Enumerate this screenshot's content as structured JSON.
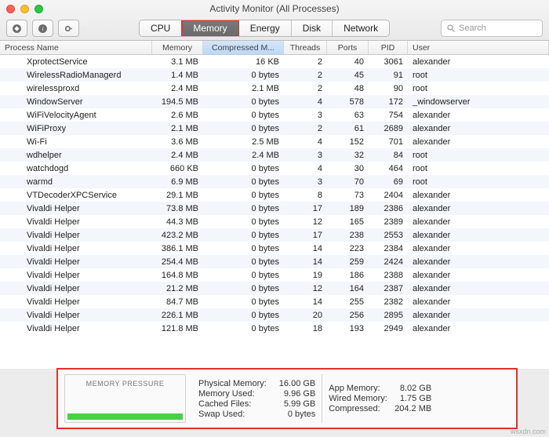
{
  "window": {
    "title": "Activity Monitor (All Processes)"
  },
  "toolbar": {
    "tabs": {
      "cpu": "CPU",
      "memory": "Memory",
      "energy": "Energy",
      "disk": "Disk",
      "network": "Network"
    }
  },
  "search": {
    "placeholder": "Search"
  },
  "columns": {
    "name": "Process Name",
    "memory": "Memory",
    "compressed": "Compressed M...",
    "threads": "Threads",
    "ports": "Ports",
    "pid": "PID",
    "user": "User"
  },
  "processes": [
    {
      "name": "XprotectService",
      "mem": "3.1 MB",
      "comp": "16 KB",
      "thr": "2",
      "port": "40",
      "pid": "3061",
      "user": "alexander"
    },
    {
      "name": "WirelessRadioManagerd",
      "mem": "1.4 MB",
      "comp": "0 bytes",
      "thr": "2",
      "port": "45",
      "pid": "91",
      "user": "root"
    },
    {
      "name": "wirelessproxd",
      "mem": "2.4 MB",
      "comp": "2.1 MB",
      "thr": "2",
      "port": "48",
      "pid": "90",
      "user": "root"
    },
    {
      "name": "WindowServer",
      "mem": "194.5 MB",
      "comp": "0 bytes",
      "thr": "4",
      "port": "578",
      "pid": "172",
      "user": "_windowserver"
    },
    {
      "name": "WiFiVelocityAgent",
      "mem": "2.6 MB",
      "comp": "0 bytes",
      "thr": "3",
      "port": "63",
      "pid": "754",
      "user": "alexander"
    },
    {
      "name": "WiFiProxy",
      "mem": "2.1 MB",
      "comp": "0 bytes",
      "thr": "2",
      "port": "61",
      "pid": "2689",
      "user": "alexander"
    },
    {
      "name": "Wi-Fi",
      "mem": "3.6 MB",
      "comp": "2.5 MB",
      "thr": "4",
      "port": "152",
      "pid": "701",
      "user": "alexander"
    },
    {
      "name": "wdhelper",
      "mem": "2.4 MB",
      "comp": "2.4 MB",
      "thr": "3",
      "port": "32",
      "pid": "84",
      "user": "root"
    },
    {
      "name": "watchdogd",
      "mem": "660 KB",
      "comp": "0 bytes",
      "thr": "4",
      "port": "30",
      "pid": "464",
      "user": "root"
    },
    {
      "name": "warmd",
      "mem": "6.9 MB",
      "comp": "0 bytes",
      "thr": "3",
      "port": "70",
      "pid": "69",
      "user": "root"
    },
    {
      "name": "VTDecoderXPCService",
      "mem": "29.1 MB",
      "comp": "0 bytes",
      "thr": "8",
      "port": "73",
      "pid": "2404",
      "user": "alexander"
    },
    {
      "name": "Vivaldi Helper",
      "mem": "73.8 MB",
      "comp": "0 bytes",
      "thr": "17",
      "port": "189",
      "pid": "2386",
      "user": "alexander"
    },
    {
      "name": "Vivaldi Helper",
      "mem": "44.3 MB",
      "comp": "0 bytes",
      "thr": "12",
      "port": "165",
      "pid": "2389",
      "user": "alexander"
    },
    {
      "name": "Vivaldi Helper",
      "mem": "423.2 MB",
      "comp": "0 bytes",
      "thr": "17",
      "port": "238",
      "pid": "2553",
      "user": "alexander"
    },
    {
      "name": "Vivaldi Helper",
      "mem": "386.1 MB",
      "comp": "0 bytes",
      "thr": "14",
      "port": "223",
      "pid": "2384",
      "user": "alexander"
    },
    {
      "name": "Vivaldi Helper",
      "mem": "254.4 MB",
      "comp": "0 bytes",
      "thr": "14",
      "port": "259",
      "pid": "2424",
      "user": "alexander"
    },
    {
      "name": "Vivaldi Helper",
      "mem": "164.8 MB",
      "comp": "0 bytes",
      "thr": "19",
      "port": "186",
      "pid": "2388",
      "user": "alexander"
    },
    {
      "name": "Vivaldi Helper",
      "mem": "21.2 MB",
      "comp": "0 bytes",
      "thr": "12",
      "port": "164",
      "pid": "2387",
      "user": "alexander"
    },
    {
      "name": "Vivaldi Helper",
      "mem": "84.7 MB",
      "comp": "0 bytes",
      "thr": "14",
      "port": "255",
      "pid": "2382",
      "user": "alexander"
    },
    {
      "name": "Vivaldi Helper",
      "mem": "226.1 MB",
      "comp": "0 bytes",
      "thr": "20",
      "port": "256",
      "pid": "2895",
      "user": "alexander"
    },
    {
      "name": "Vivaldi Helper",
      "mem": "121.8 MB",
      "comp": "0 bytes",
      "thr": "18",
      "port": "193",
      "pid": "2949",
      "user": "alexander"
    }
  ],
  "memory_panel": {
    "pressure_label": "MEMORY PRESSURE",
    "left": [
      {
        "lab": "Physical Memory:",
        "val": "16.00 GB"
      },
      {
        "lab": "Memory Used:",
        "val": "9.96 GB"
      },
      {
        "lab": "Cached Files:",
        "val": "5.99 GB"
      },
      {
        "lab": "Swap Used:",
        "val": "0 bytes"
      }
    ],
    "right": [
      {
        "lab": "App Memory:",
        "val": "8.02 GB"
      },
      {
        "lab": "Wired Memory:",
        "val": "1.75 GB"
      },
      {
        "lab": "Compressed:",
        "val": "204.2 MB"
      }
    ]
  },
  "watermark": "wsxdn.com"
}
